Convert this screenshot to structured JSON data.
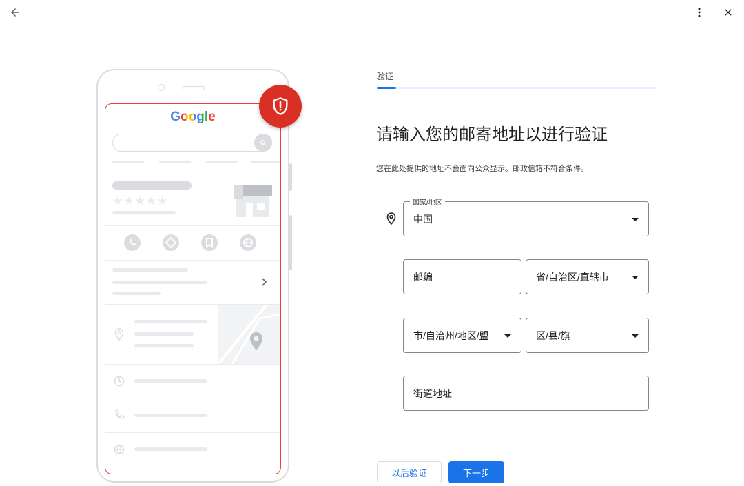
{
  "window": {
    "back_icon": "arrow-left-icon",
    "more_icon": "more-vert-icon",
    "close_icon": "close-icon"
  },
  "illustration": {
    "brand": "Google",
    "rating_stars": "★★★★★"
  },
  "stepper": {
    "step_label": "验证",
    "progress_fraction": 0.07
  },
  "form": {
    "heading": "请输入您的邮寄地址以进行验证",
    "subtext": "您在此处提供的地址不会面向公众显示。邮政信箱不符合条件。",
    "country": {
      "label": "国家/地区",
      "value": "中国"
    },
    "postal_code": {
      "placeholder": "邮编"
    },
    "province": {
      "placeholder": "省/自治区/直辖市"
    },
    "city": {
      "placeholder": "市/自治州/地区/盟"
    },
    "district": {
      "placeholder": "区/县/旗"
    },
    "street": {
      "placeholder": "街道地址"
    }
  },
  "actions": {
    "later_label": "以后验证",
    "next_label": "下一步"
  },
  "colors": {
    "accent": "#1a73e8",
    "danger": "#d93025",
    "outline": "#80868b",
    "placeholder_gray": "#dadce0"
  }
}
